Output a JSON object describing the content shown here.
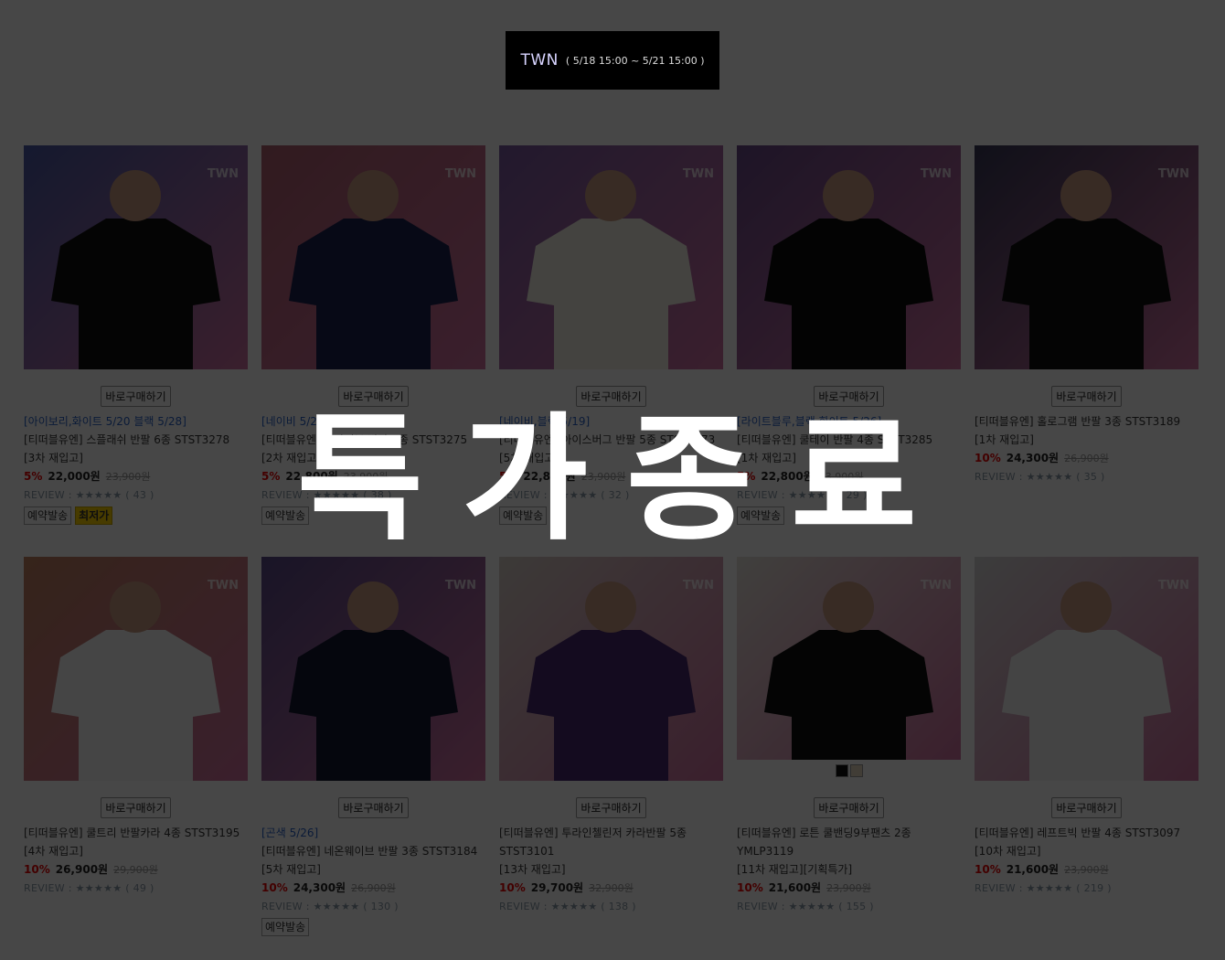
{
  "banner": {
    "brand": "TWN",
    "period": "( 5/18 15:00 ~ 5/21 15:00 )"
  },
  "overlay_text": "특가종료",
  "buy_label": "바로구매하기",
  "products": [
    {
      "color_note": "[아이보리,화이트 5/20 블랙 5/28]",
      "name": "[티떠블유엔] 스플래쉬 반팔 6종 STST3278",
      "restock": "[3차 재입고]",
      "discount": "5%",
      "price": "22,000원",
      "original": "23,900원",
      "review": "REVIEW : ★★★★★ ( 43 )",
      "tags": [
        "예약발송",
        "최저가"
      ],
      "bg": "#4a5aa8",
      "shirt": "#111"
    },
    {
      "color_note": "[네이비 5/22]",
      "name": "[티떠블유엔] 굿바이브 반팔 4종 STST3275",
      "restock": "[2차 재입고]",
      "discount": "5%",
      "price": "22,800원",
      "original": "23,900원",
      "review": "REVIEW : ★★★★★ ( 38 )",
      "tags": [
        "예약발송"
      ],
      "bg": "#b06070",
      "shirt": "#1c2250"
    },
    {
      "color_note": "[네이비,블랙 5/19]",
      "name": "[티떠블유엔] 아이스버그 반팔 5종 STST3273",
      "restock": "[5차 재입고]",
      "discount": "5%",
      "price": "22,800원",
      "original": "23,900원",
      "review": "REVIEW : ★★★★★ ( 32 )",
      "tags": [
        "예약발송"
      ],
      "bg": "#7a5aa0",
      "shirt": "#f2efe4"
    },
    {
      "color_note": "[라이트블루,블랙,화이트 5/26]",
      "name": "[티떠블유엔] 쿨테이 반팔 4종 STST3285",
      "restock": "[1차 재입고]",
      "discount": "5%",
      "price": "22,800원",
      "original": "23,900원",
      "review": "REVIEW : ★★★★★ ( 29 )",
      "tags": [
        "예약발송"
      ],
      "bg": "#6a4a8a",
      "shirt": "#0e0e0e"
    },
    {
      "color_note": "",
      "name": "[티떠블유엔] 홀로그램 반팔 3종 STST3189",
      "restock": "[1차 재입고]",
      "discount": "10%",
      "price": "24,300원",
      "original": "26,900원",
      "review": "REVIEW : ★★★★★ ( 35 )",
      "tags": [],
      "bg": "#3a3a5a",
      "shirt": "#111"
    },
    {
      "color_note": "",
      "name": "[티떠블유엔] 쿨트리 반팔카라 4종 STST3195",
      "restock": "[4차 재입고]",
      "discount": "10%",
      "price": "26,900원",
      "original": "29,900원",
      "review": "REVIEW : ★★★★★ ( 49 )",
      "tags": [],
      "bg": "#c08060",
      "shirt": "#f6f6f6"
    },
    {
      "color_note": "[곤색 5/26]",
      "name": "[티떠블유엔] 네온웨이브 반팔 3종 STST3184",
      "restock": "[5차 재입고]",
      "discount": "10%",
      "price": "24,300원",
      "original": "26,900원",
      "review": "REVIEW : ★★★★★ ( 130 )",
      "tags": [
        "예약발송"
      ],
      "bg": "#5a4a8a",
      "shirt": "#151830"
    },
    {
      "color_note": "",
      "name": "[티떠블유엔] 투라인첼린저 카라반팔 5종 STST3101",
      "restock": "[13차 재입고]",
      "discount": "10%",
      "price": "29,700원",
      "original": "32,900원",
      "review": "REVIEW : ★★★★★ ( 138 )",
      "tags": [],
      "bg": "#d8d0c8",
      "shirt": "#4a2a70"
    },
    {
      "color_note": "",
      "name": "[티떠블유엔] 로튼 쿨밴딩9부팬츠 2종 YMLP3119",
      "restock": "[11차 재입고][기획특가]",
      "discount": "10%",
      "price": "21,600원",
      "original": "23,900원",
      "review": "REVIEW : ★★★★★ ( 155 )",
      "tags": [],
      "bg": "#e8e4dc",
      "shirt": "#111",
      "swatches": [
        "#111111",
        "#e8dcc0"
      ]
    },
    {
      "color_note": "",
      "name": "[티떠블유엔] 레프트빅 반팔 4종 STST3097",
      "restock": "[10차 재입고]",
      "discount": "10%",
      "price": "21,600원",
      "original": "23,900원",
      "review": "REVIEW : ★★★★★ ( 219 )",
      "tags": [],
      "bg": "#d8d8d8",
      "shirt": "#f4f4f4"
    }
  ]
}
